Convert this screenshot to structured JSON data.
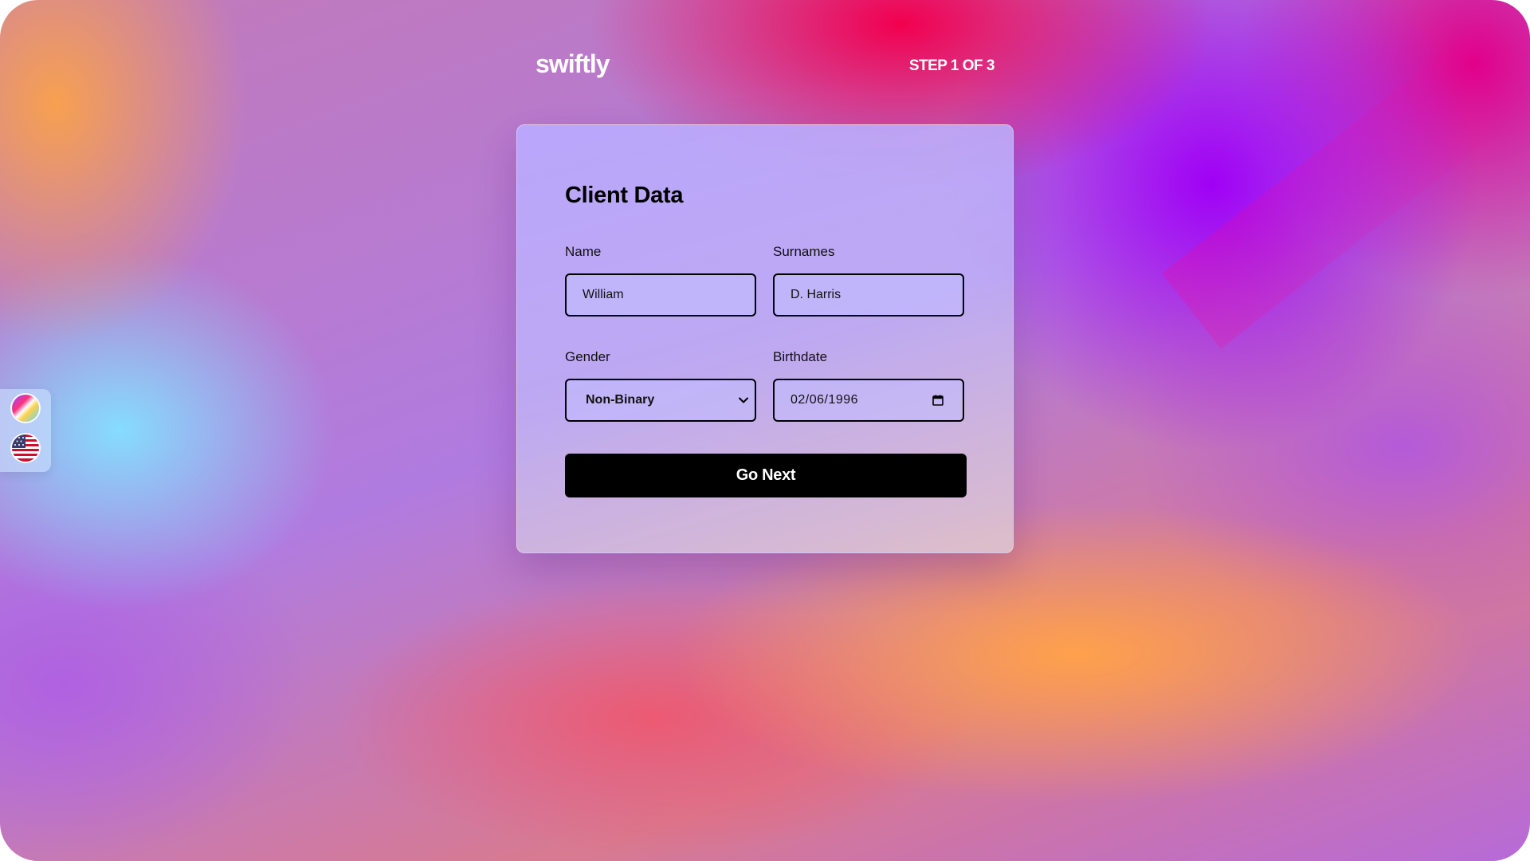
{
  "header": {
    "logo": "swiftly",
    "step": "STEP 1 OF 3"
  },
  "form": {
    "title": "Client Data",
    "name": {
      "label": "Name",
      "value": "William"
    },
    "surnames": {
      "label": "Surnames",
      "value": "D. Harris"
    },
    "gender": {
      "label": "Gender",
      "value": "Non-Binary"
    },
    "birthdate": {
      "label": "Birthdate",
      "value": "02/06/1996"
    },
    "next_label": "Go Next"
  },
  "side_panel": {
    "icons": [
      "color-palette-icon",
      "us-flag-icon"
    ]
  }
}
